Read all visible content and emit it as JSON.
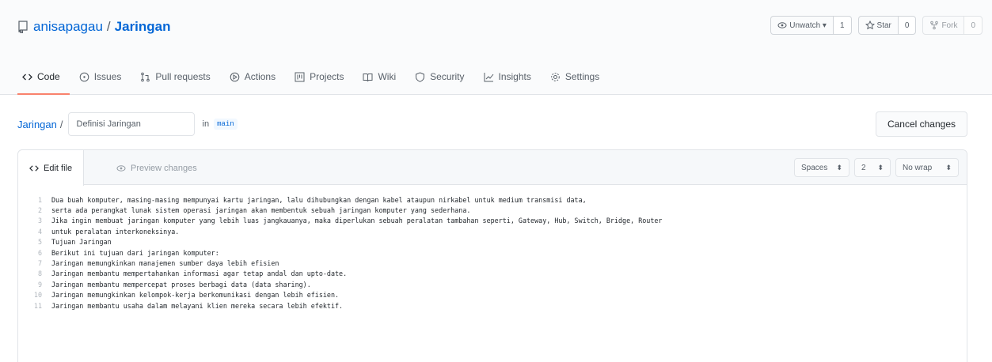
{
  "repo": {
    "owner": "anisapagau",
    "separator": "/",
    "name": "Jaringan"
  },
  "actions": {
    "watch": {
      "label": "Unwatch ▾",
      "count": "1"
    },
    "star": {
      "label": "Star",
      "count": "0"
    },
    "fork": {
      "label": "Fork",
      "count": "0"
    }
  },
  "tabs": [
    {
      "label": "Code"
    },
    {
      "label": "Issues"
    },
    {
      "label": "Pull requests"
    },
    {
      "label": "Actions"
    },
    {
      "label": "Projects"
    },
    {
      "label": "Wiki"
    },
    {
      "label": "Security"
    },
    {
      "label": "Insights"
    },
    {
      "label": "Settings"
    }
  ],
  "editor_bar": {
    "path_root": "Jaringan",
    "path_sep": "/",
    "filename": "Definisi Jaringan",
    "in_label": "in",
    "branch": "main",
    "cancel_label": "Cancel changes"
  },
  "editor": {
    "edit_tab": "Edit file",
    "preview_tab": "Preview changes",
    "indent_mode": "Spaces",
    "indent_size": "2",
    "wrap_mode": "No wrap",
    "lines": [
      {
        "n": "1",
        "text": "Dua buah komputer, masing-masing mempunyai kartu jaringan, lalu dihubungkan dengan kabel ataupun nirkabel untuk medium transmisi data,"
      },
      {
        "n": "2",
        "text": "serta ada perangkat lunak sistem operasi jaringan akan membentuk sebuah jaringan komputer yang sederhana."
      },
      {
        "n": "3",
        "text": "Jika ingin membuat jaringan komputer yang lebih luas jangkauanya, maka diperlukan sebuah peralatan tambahan seperti, Gateway, Hub, Switch, Bridge, Router"
      },
      {
        "n": "4",
        "text": "untuk peralatan interkoneksinya."
      },
      {
        "n": "5",
        "text": "Tujuan Jaringan"
      },
      {
        "n": "6",
        "text": "Berikut ini tujuan dari jaringan komputer:"
      },
      {
        "n": "7",
        "text": "Jaringan memungkinkan manajemen sumber daya lebih efisien"
      },
      {
        "n": "8",
        "text": "Jaringan membantu mempertahankan informasi agar tetap andal dan upto-date."
      },
      {
        "n": "9",
        "text": "Jaringan membantu mempercepat proses berbagi data (data sharing)."
      },
      {
        "n": "10",
        "text": "Jaringan memungkinkan kelompok-kerja berkomunikasi dengan lebih efisien."
      },
      {
        "n": "11",
        "text": "Jaringan membantu usaha dalam melayani klien mereka secara lebih efektif."
      }
    ]
  },
  "colors": {
    "link": "#0366d6",
    "tab_underline": "#f9826c"
  }
}
